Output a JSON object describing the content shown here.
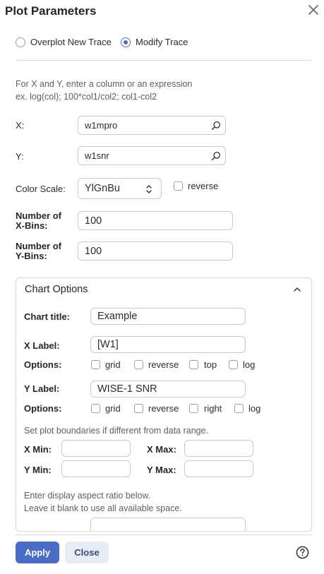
{
  "dialog": {
    "title": "Plot Parameters"
  },
  "mode": {
    "options": [
      {
        "label": "Overplot New Trace",
        "selected": false
      },
      {
        "label": "Modify Trace",
        "selected": true
      }
    ]
  },
  "instructions": {
    "line1": "For X and Y, enter a column or an expression",
    "line2": "ex. log(col); 100*col1/col2; col1-col2"
  },
  "fields": {
    "x": {
      "label": "X:",
      "value": "w1mpro"
    },
    "y": {
      "label": "Y:",
      "value": "w1snr"
    },
    "color_scale": {
      "label": "Color Scale:",
      "value": "YlGnBu",
      "reverse_label": "reverse"
    },
    "xbins": {
      "label_line1": "Number of",
      "label_line2": "X-Bins:",
      "value": "100"
    },
    "ybins": {
      "label_line1": "Number of",
      "label_line2": "Y-Bins:",
      "value": "100"
    }
  },
  "chart_options": {
    "header": "Chart Options",
    "chart_title": {
      "label": "Chart title:",
      "value": "Example"
    },
    "x_label": {
      "label": "X Label:",
      "value": "[W1]"
    },
    "x_options": {
      "label": "Options:",
      "items": [
        "grid",
        "reverse",
        "top",
        "log"
      ]
    },
    "y_label": {
      "label": "Y Label:",
      "value": "WISE-1 SNR"
    },
    "y_options": {
      "label": "Options:",
      "items": [
        "grid",
        "reverse",
        "right",
        "log"
      ]
    },
    "boundaries_note": "Set plot boundaries if different from data range.",
    "x_min": {
      "label": "X Min:",
      "value": ""
    },
    "x_max": {
      "label": "X Max:",
      "value": ""
    },
    "y_min": {
      "label": "Y Min:",
      "value": ""
    },
    "y_max": {
      "label": "Y Max:",
      "value": ""
    },
    "aspect_note_line1": "Enter display aspect ratio below.",
    "aspect_note_line2": "Leave it blank to use all available space."
  },
  "footer": {
    "apply_label": "Apply",
    "close_label": "Close"
  },
  "colors": {
    "accent": "#4a6cc6",
    "secondary_button_bg": "#e6ecf6"
  }
}
